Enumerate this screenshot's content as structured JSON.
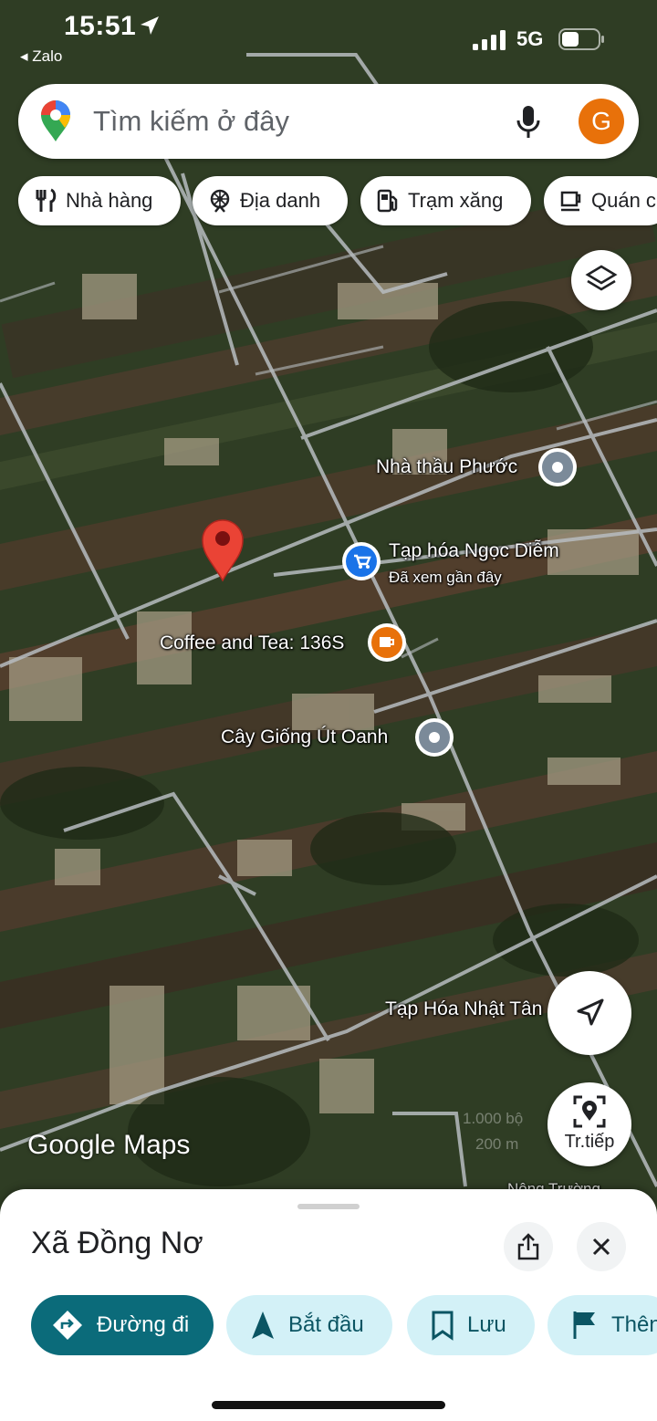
{
  "status_bar": {
    "time": "15:51",
    "back_app": "◂ Zalo",
    "network": "5G"
  },
  "search": {
    "placeholder": "Tìm kiếm ở đây",
    "avatar_letter": "G"
  },
  "chips": [
    {
      "label": "Nhà hàng",
      "icon": "restaurant-icon"
    },
    {
      "label": "Địa danh",
      "icon": "attraction-icon"
    },
    {
      "label": "Trạm xăng",
      "icon": "gas-station-icon"
    },
    {
      "label": "Quán c",
      "icon": "coffee-icon"
    }
  ],
  "map_labels": {
    "contractor": "Nhà thầu Phước",
    "grocery": "Tạp hóa Ngọc Diễm",
    "grocery_sub": "Đã xem gần đây",
    "coffee": "Coffee and Tea: 136S",
    "nursery": "Cây Giống Út Oanh",
    "grocery2": "Tạp Hóa Nhật Tân",
    "farm": "Nông Trường"
  },
  "scale": {
    "feet": "1.000 bộ",
    "meters": "200 m"
  },
  "live_view_label": "Tr.tiếp",
  "google_logo": "Google Maps",
  "place": {
    "title": "Xã Đồng Nơ"
  },
  "actions": {
    "directions": "Đường đi",
    "start": "Bắt đầu",
    "save": "Lưu",
    "more": "Thên"
  },
  "colors": {
    "accent_teal": "#0b6b7a",
    "action_bg": "#d3f1f7",
    "avatar": "#e8710a",
    "pin_red": "#ea4335",
    "poi_blue": "#1a73e8",
    "poi_orange": "#e8710a",
    "poi_gray": "#7b8a99"
  }
}
